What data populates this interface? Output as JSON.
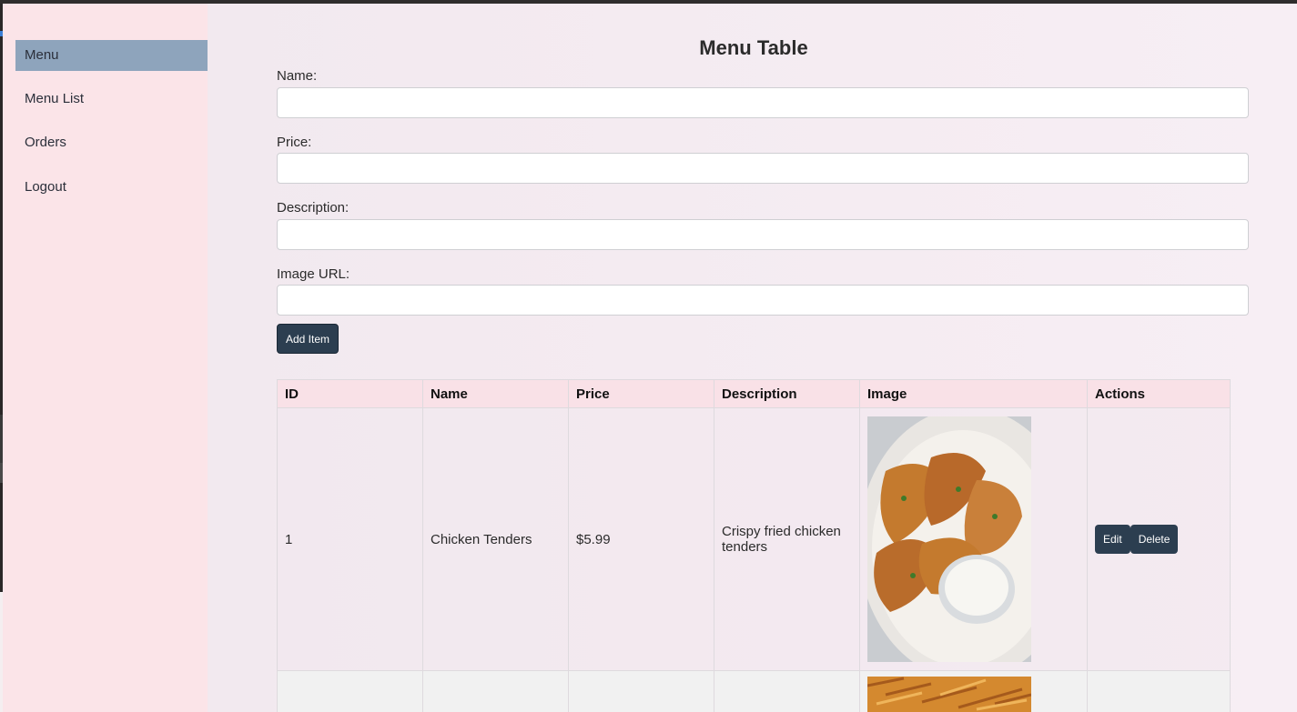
{
  "sidebar": {
    "items": [
      {
        "label": "Menu",
        "active": true
      },
      {
        "label": "Menu List",
        "active": false
      },
      {
        "label": "Orders",
        "active": false
      },
      {
        "label": "Logout",
        "active": false
      }
    ]
  },
  "page": {
    "title": "Menu Table"
  },
  "form": {
    "name_label": "Name:",
    "name_value": "",
    "price_label": "Price:",
    "price_value": "",
    "description_label": "Description:",
    "description_value": "",
    "image_url_label": "Image URL:",
    "image_url_value": "",
    "add_button": "Add Item"
  },
  "table": {
    "headers": [
      "ID",
      "Name",
      "Price",
      "Description",
      "Image",
      "Actions"
    ],
    "rows": [
      {
        "id": "1",
        "name": "Chicken Tenders",
        "price": "$5.99",
        "description": "Crispy fried chicken tenders",
        "image": "chicken-tenders-photo",
        "edit_label": "Edit",
        "delete_label": "Delete"
      }
    ],
    "partial_row": {
      "image": "fries-photo"
    }
  },
  "colors": {
    "sidebar_bg": "#fbe4e8",
    "active_item": "#8ea4bc",
    "button": "#2c3e50",
    "header_bg": "#f9e1e7"
  }
}
